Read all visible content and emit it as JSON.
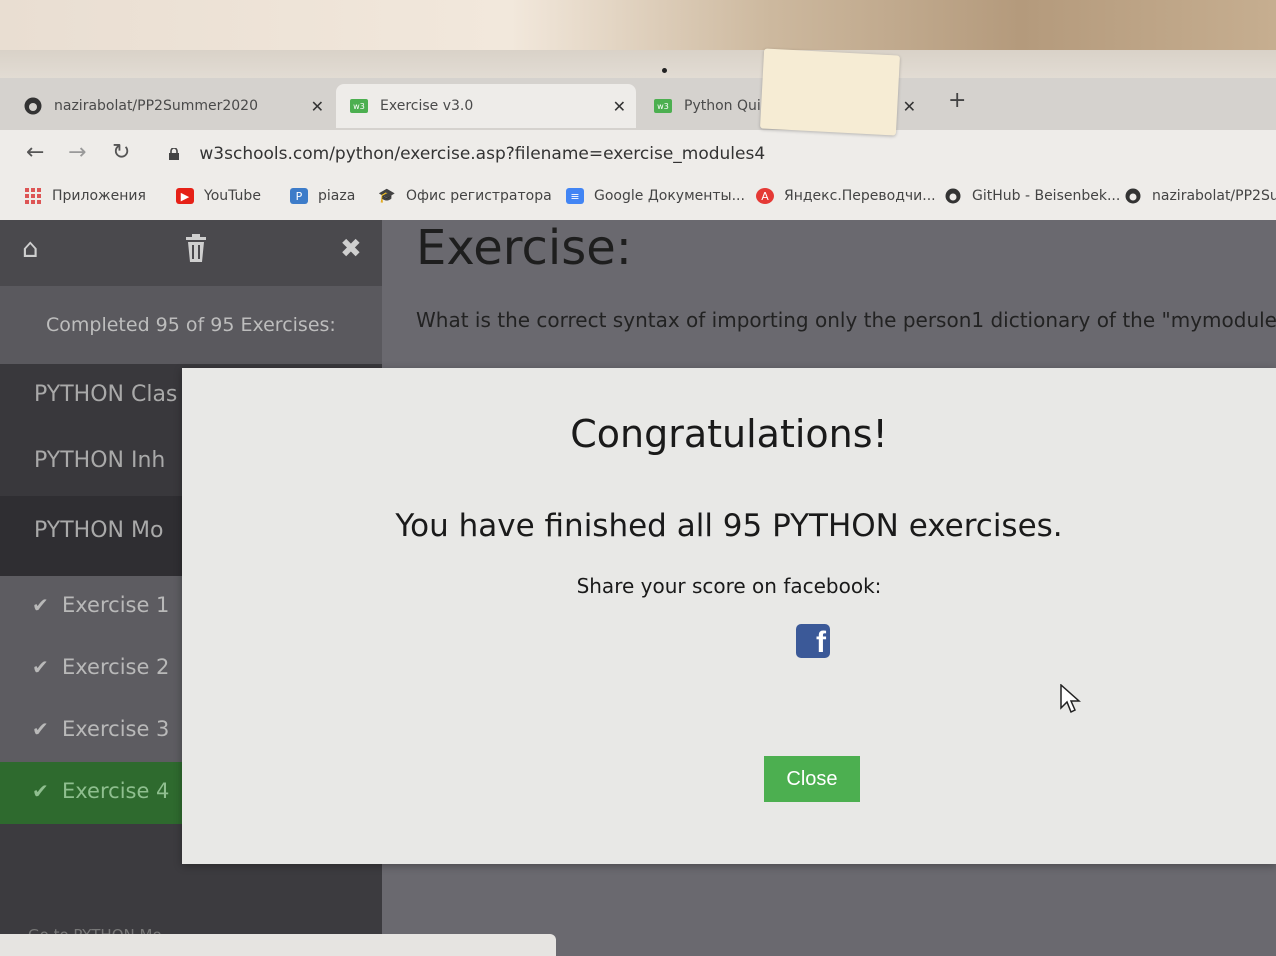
{
  "tabs": [
    {
      "label": "nazirabolat/PP2Summer2020",
      "icon": "github-icon"
    },
    {
      "label": "Exercise v3.0",
      "icon": "w3schools-icon"
    },
    {
      "label": "Python Quiz",
      "icon": "w3schools-icon"
    }
  ],
  "address": {
    "url": "w3schools.com/python/exercise.asp?filename=exercise_modules4"
  },
  "bookmarks": [
    {
      "label": "Приложения",
      "icon": "apps-grid-icon"
    },
    {
      "label": "YouTube",
      "icon": "youtube-icon"
    },
    {
      "label": "piaza",
      "icon": "piazza-icon"
    },
    {
      "label": "Офис регистратора",
      "icon": "graduation-cap-icon"
    },
    {
      "label": "Google Документы...",
      "icon": "google-docs-icon"
    },
    {
      "label": "Яндекс.Переводчи...",
      "icon": "yandex-translate-icon"
    },
    {
      "label": "GitHub - Beisenbek...",
      "icon": "github-icon"
    },
    {
      "label": "nazirabolat/PP2Su...",
      "icon": "github-icon"
    }
  ],
  "sidebar": {
    "completed": "Completed 95 of 95 Exercises:",
    "sections": [
      "PYTHON Clas",
      "PYTHON Inh",
      "PYTHON Mo"
    ],
    "exercises": [
      "Exercise 1",
      "Exercise 2",
      "Exercise 3",
      "Exercise 4"
    ],
    "goto": "Go to PYTHON Mo"
  },
  "main": {
    "title": "Exercise:",
    "question": "What is the correct syntax of importing only the person1 dictionary of the \"mymodule"
  },
  "modal": {
    "title": "Congratulations!",
    "message": "You have finished all 95 PYTHON exercises.",
    "share": "Share your score on facebook:",
    "close_label": "Close",
    "fb_glyph": "f"
  },
  "colors": {
    "accent": "#4caf50",
    "facebook": "#3b5998",
    "current_exercise": "#2e6a2e"
  }
}
